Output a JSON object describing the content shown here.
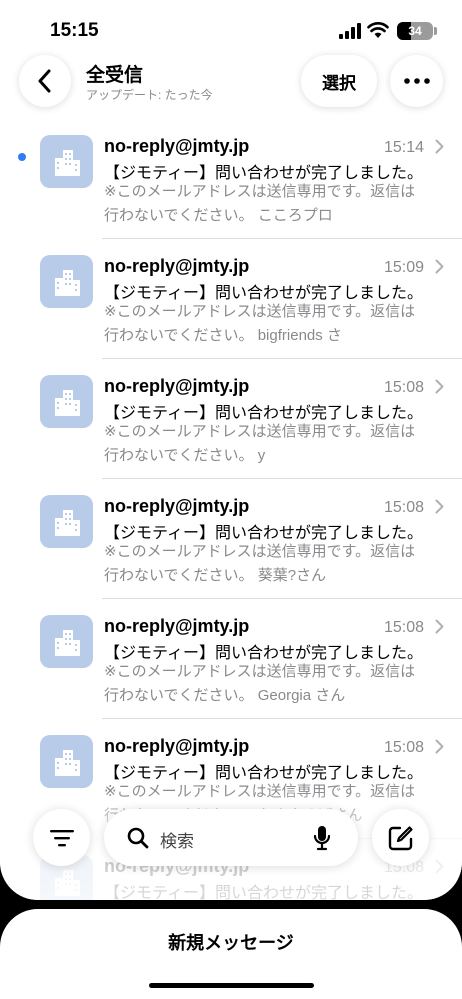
{
  "status_bar": {
    "time": "15:15",
    "battery": "34"
  },
  "header": {
    "title": "全受信",
    "subtitle": "アップデート: たった今",
    "select_label": "選択"
  },
  "mails": [
    {
      "sender": "no-reply@jmty.jp",
      "time": "15:14",
      "subject": "【ジモティー】問い合わせが完了しました。",
      "preview": "※このメールアドレスは送信専用です。返信は行わないでください。 こころプロ",
      "unread": true
    },
    {
      "sender": "no-reply@jmty.jp",
      "time": "15:09",
      "subject": "【ジモティー】問い合わせが完了しました。",
      "preview": "※このメールアドレスは送信専用です。返信は行わないでください。 bigfriends さ",
      "unread": false
    },
    {
      "sender": "no-reply@jmty.jp",
      "time": "15:08",
      "subject": "【ジモティー】問い合わせが完了しました。",
      "preview": "※このメールアドレスは送信専用です。返信は行わないでください。 y",
      "unread": false
    },
    {
      "sender": "no-reply@jmty.jp",
      "time": "15:08",
      "subject": "【ジモティー】問い合わせが完了しました。",
      "preview": "※このメールアドレスは送信専用です。返信は行わないでください。 葵葉?さん",
      "unread": false
    },
    {
      "sender": "no-reply@jmty.jp",
      "time": "15:08",
      "subject": "【ジモティー】問い合わせが完了しました。",
      "preview": "※このメールアドレスは送信専用です。返信は行わないでください。 Georgia さん",
      "unread": false
    },
    {
      "sender": "no-reply@jmty.jp",
      "time": "15:08",
      "subject": "【ジモティー】問い合わせが完了しました。",
      "preview": "※このメールアドレスは送信専用です。返信は行わないでください。 たぬきそばさん",
      "unread": false
    },
    {
      "sender": "no-reply@jmty.jp",
      "time": "15:08",
      "subject": "【ジモティー】問い合わせが完了しました。",
      "preview": "",
      "unread": false
    }
  ],
  "toolbar": {
    "search_placeholder": "検索"
  },
  "new_message": {
    "label": "新規メッセージ"
  },
  "colors": {
    "unread_dot": "#2f7cf6",
    "avatar_bg": "#b8cbe8",
    "secondary_text": "#8a8a8e"
  },
  "icons": {
    "back": "chevron-left-icon",
    "more": "ellipsis-icon",
    "avatar": "building-icon",
    "filter": "filter-lines-icon",
    "search": "magnifier-icon",
    "mic": "microphone-icon",
    "compose": "compose-icon"
  }
}
